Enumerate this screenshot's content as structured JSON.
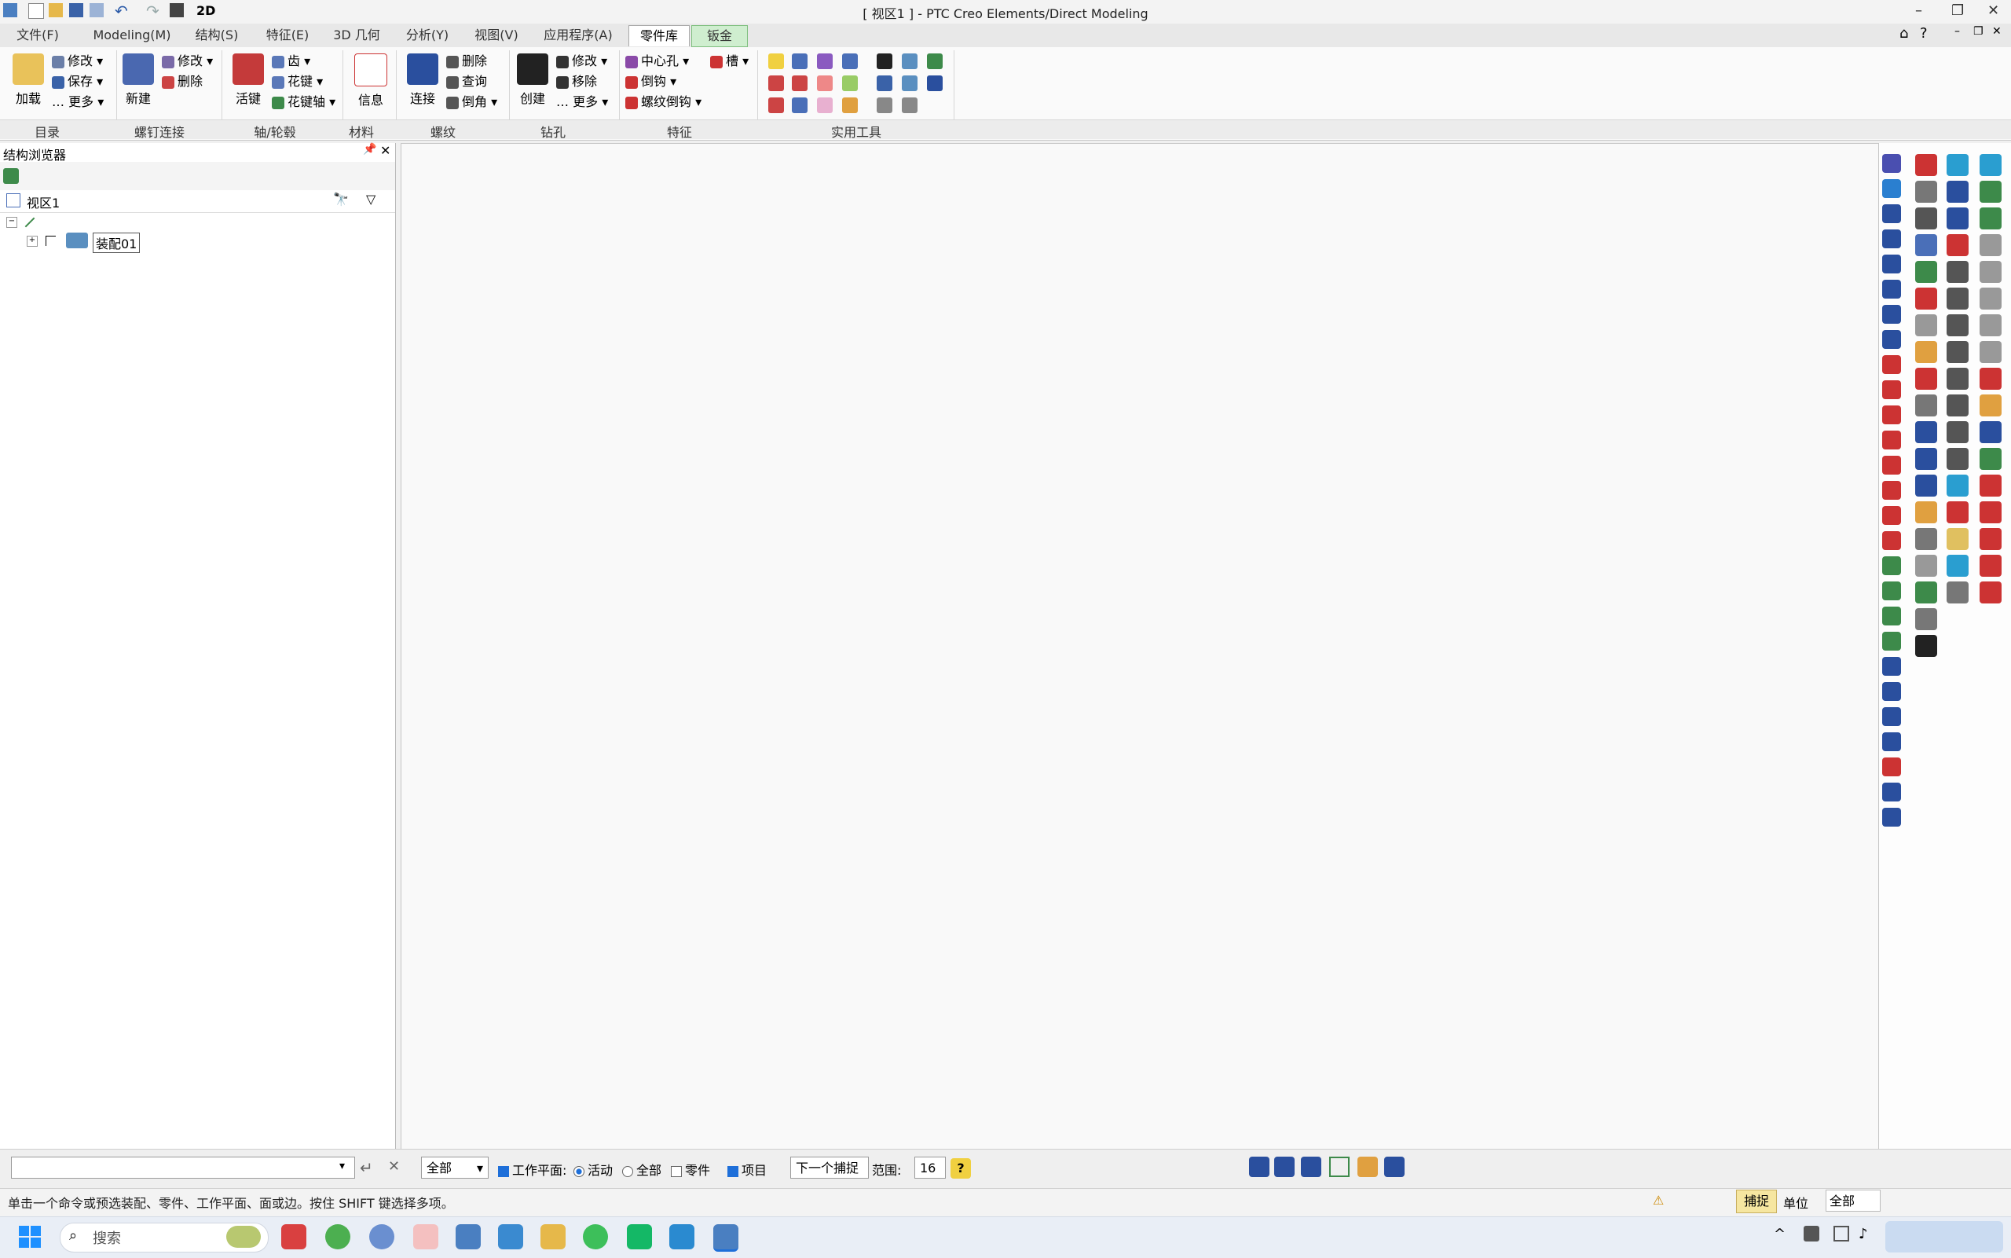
{
  "window": {
    "title": "[ 视区1 ] - PTC Creo Elements/Direct Modeling",
    "qa_2d": "2D"
  },
  "tabs": [
    "文件(F)",
    "Modeling(M)",
    "结构(S)",
    "特征(E)",
    "3D 几何",
    "分析(Y)",
    "视图(V)",
    "应用程序(A)",
    "零件库",
    "钣金"
  ],
  "ribbon": {
    "catalog": {
      "load": "加载",
      "modify": "修改",
      "save": "保存",
      "more": "更多"
    },
    "bolt": {
      "new": "新建",
      "modify": "修改",
      "delete": "删除"
    },
    "shaft": {
      "piston": "活键",
      "gear": "齿",
      "spline": "花键",
      "spline_shaft": "花键轴"
    },
    "material": {
      "info": "信息"
    },
    "thread": {
      "connect": "连接",
      "delete": "删除",
      "query": "查询",
      "chamfer": "倒角"
    },
    "drill": {
      "create": "创建",
      "modify": "修改",
      "move": "移除",
      "more": "更多"
    },
    "feature": {
      "center_hole": "中心孔",
      "slot": "槽",
      "chamfer": "倒钩",
      "thread_chamfer": "螺纹倒钩"
    }
  },
  "groups": [
    "目录",
    "螺钉连接",
    "轴/轮毂",
    "材料",
    "螺纹",
    "钻孔",
    "特征",
    "实用工具"
  ],
  "browser": {
    "title": "结构浏览器",
    "view": "视区1",
    "assembly": "装配01"
  },
  "input_row": {
    "filter": "全部",
    "workplane": "工作平面:",
    "active": "活动",
    "all": "全部",
    "part": "零件",
    "item": "项目",
    "next_snap": "下一个捕捉",
    "range_label": "范围:",
    "range_value": "16"
  },
  "status": {
    "message": "单击一个命令或预选装配、零件、工作平面、面或边。按住 SHIFT 键选择多项。",
    "snap": "捕捉",
    "unit": "单位",
    "all": "全部"
  },
  "taskbar": {
    "search": "搜索"
  },
  "colors": {
    "accent": "#1e6fd9",
    "sheetmetal_tab": "#cfeecf"
  }
}
